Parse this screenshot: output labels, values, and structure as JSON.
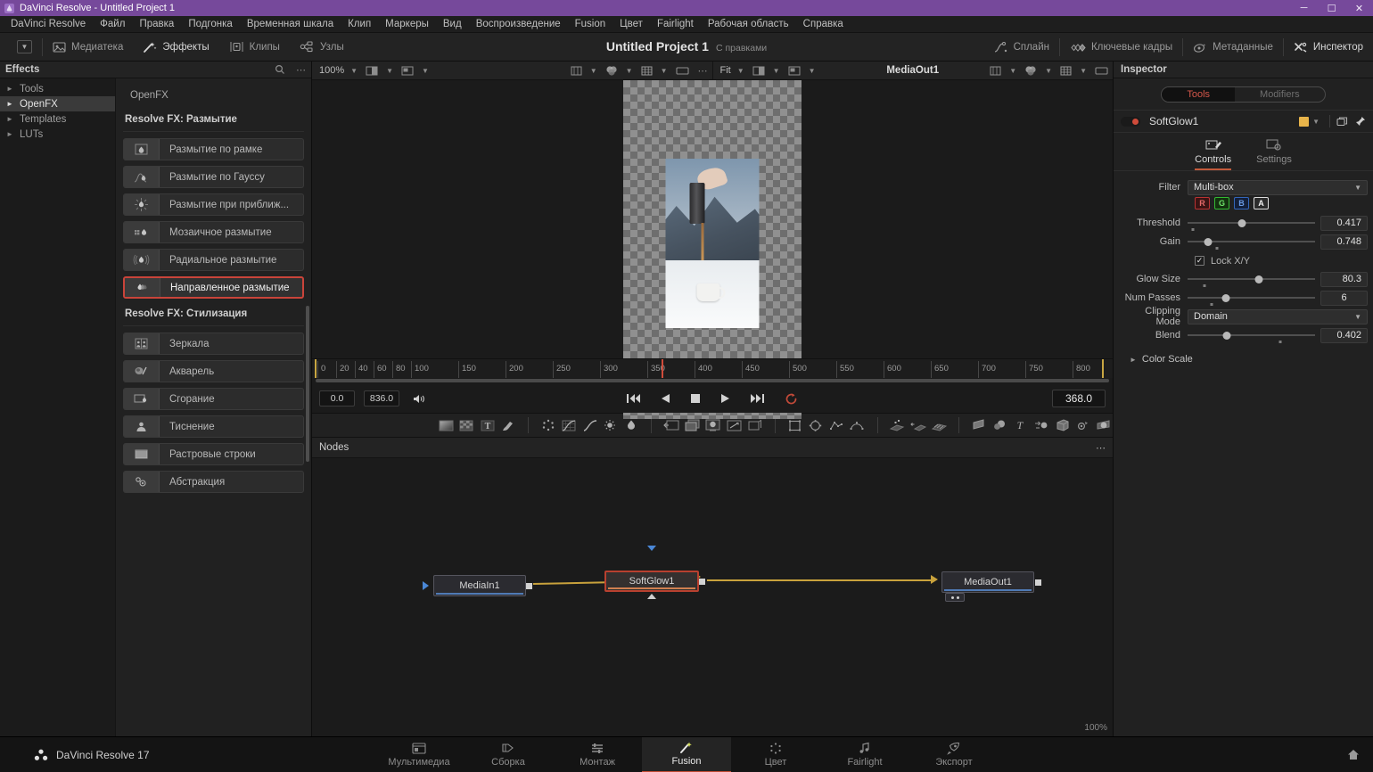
{
  "titlebar": {
    "title": "DaVinci Resolve - Untitled Project 1",
    "minimize": "─",
    "maximize": "☐",
    "close": "✕"
  },
  "menubar": {
    "items": [
      "DaVinci Resolve",
      "Файл",
      "Правка",
      "Подгонка",
      "Временная шкала",
      "Клип",
      "Маркеры",
      "Вид",
      "Воспроизведение",
      "Fusion",
      "Цвет",
      "Fairlight",
      "Рабочая область",
      "Справка"
    ]
  },
  "toolbar": {
    "left": [
      {
        "label": "",
        "icon": "chevron-down-box-icon",
        "active": false
      },
      {
        "label": "Медиатека",
        "icon": "media-pool-icon",
        "active": false
      },
      {
        "label": "Эффекты",
        "icon": "effects-wand-icon",
        "active": true
      },
      {
        "label": "Клипы",
        "icon": "clips-icon",
        "active": false
      },
      {
        "label": "Узлы",
        "icon": "nodes-icon",
        "active": false
      }
    ],
    "right": [
      {
        "label": "Сплайн",
        "icon": "spline-icon"
      },
      {
        "label": "Ключевые кадры",
        "icon": "keyframes-icon"
      },
      {
        "label": "Метаданные",
        "icon": "metadata-icon"
      },
      {
        "label": "Инспектор",
        "icon": "inspector-icon"
      }
    ],
    "project_title": "Untitled Project 1",
    "project_sub": "С правками"
  },
  "effects": {
    "header": "Effects",
    "tree": [
      {
        "label": "Tools",
        "selected": false
      },
      {
        "label": "OpenFX",
        "selected": true
      },
      {
        "label": "Templates",
        "selected": false
      },
      {
        "label": "LUTs",
        "selected": false
      }
    ],
    "breadcrumb": "OpenFX",
    "groups": [
      {
        "title": "Resolve FX: Размытие",
        "items": [
          {
            "label": "Размытие по рамке",
            "icon": "box-blur-icon",
            "selected": false
          },
          {
            "label": "Размытие по Гауссу",
            "icon": "gaussian-blur-icon",
            "selected": false
          },
          {
            "label": "Размытие при приближ...",
            "icon": "zoom-blur-icon",
            "selected": false
          },
          {
            "label": "Мозаичное размытие",
            "icon": "mosaic-blur-icon",
            "selected": false
          },
          {
            "label": "Радиальное размытие",
            "icon": "radial-blur-icon",
            "selected": false
          },
          {
            "label": "Направленное размытие",
            "icon": "directional-blur-icon",
            "selected": true
          }
        ]
      },
      {
        "title": "Resolve FX: Стилизация",
        "items": [
          {
            "label": "Зеркала",
            "icon": "mirrors-icon",
            "selected": false
          },
          {
            "label": "Акварель",
            "icon": "watercolor-icon",
            "selected": false
          },
          {
            "label": "Сгорание",
            "icon": "burn-icon",
            "selected": false
          },
          {
            "label": "Тиснение",
            "icon": "emboss-icon",
            "selected": false
          },
          {
            "label": "Растровые строки",
            "icon": "scanlines-icon",
            "selected": false
          },
          {
            "label": "Абстракция",
            "icon": "abstraction-icon",
            "selected": false
          }
        ]
      }
    ]
  },
  "viewer": {
    "left_zoom": "100%",
    "right_zoom": "Fit",
    "right_name": "MediaOut1"
  },
  "timeline": {
    "ticks": [
      "0",
      "20",
      "40",
      "60",
      "80",
      "100",
      "150",
      "200",
      "250",
      "300",
      "350",
      "400",
      "450",
      "500",
      "550",
      "600",
      "650",
      "700",
      "750",
      "800"
    ],
    "playhead": "368",
    "range_start": "0",
    "range_end": "836"
  },
  "transport": {
    "in_point": "0.0",
    "out_point": "836.0",
    "current_frame": "368.0",
    "buttons": [
      "go-to-start",
      "step-back",
      "stop",
      "play",
      "go-to-end",
      "loop"
    ]
  },
  "node_tools": {
    "group1": [
      "background-icon",
      "checkerboard-icon",
      "text-icon",
      "paint-icon"
    ],
    "group2": [
      "particles-icon",
      "color-curves-icon",
      "color-corrector-icon",
      "brightness-contrast-icon",
      "blur-icon"
    ],
    "group3": [
      "transform-icon",
      "merge-icon",
      "media-in-icon",
      "resize-icon",
      "crop-icon"
    ],
    "group4": [
      "rectangle-mask-icon",
      "ellipse-mask-icon",
      "polygon-mask-icon",
      "bspline-mask-icon"
    ],
    "group5": [
      "tracker-icon",
      "planar-tracker-icon",
      "camera-tracker-icon"
    ],
    "group6": [
      "image-plane-3d-icon",
      "shape-3d-icon",
      "text-3d-icon",
      "merge-3d-icon",
      "renderer-3d-icon",
      "camera-3d-icon",
      "sphere-map-icon"
    ]
  },
  "nodes": {
    "header": "Nodes",
    "zoom_label": "100%",
    "items": [
      {
        "label": "MediaIn1",
        "selected": false
      },
      {
        "label": "SoftGlow1",
        "selected": true
      },
      {
        "label": "MediaOut1",
        "selected": false
      }
    ]
  },
  "inspector": {
    "header": "Inspector",
    "pill": {
      "tools": "Tools",
      "modifiers": "Modifiers",
      "active": "Tools"
    },
    "tool_name": "SoftGlow1",
    "tool_color": "#e8b44a",
    "tabs": [
      {
        "label": "Controls",
        "active": true,
        "icon": "controls-icon"
      },
      {
        "label": "Settings",
        "active": false,
        "icon": "settings-icon"
      }
    ],
    "controls": {
      "filter": {
        "label": "Filter",
        "value": "Multi-box"
      },
      "channels": [
        "R",
        "G",
        "B",
        "A"
      ],
      "threshold": {
        "label": "Threshold",
        "value": "0.417",
        "pct": 43,
        "kf_pct": 4
      },
      "gain": {
        "label": "Gain",
        "value": "0.748",
        "pct": 16,
        "kf_pct": 23
      },
      "lock_xy": {
        "label": "Lock X/Y",
        "checked": true
      },
      "glow_size": {
        "label": "Glow Size",
        "value": "80.3",
        "pct": 56,
        "kf_pct": 13
      },
      "num_passes": {
        "label": "Num Passes",
        "value": "6",
        "pct": 30,
        "kf_pct": 19
      },
      "clipping_mode": {
        "label": "Clipping Mode",
        "value": "Domain"
      },
      "blend": {
        "label": "Blend",
        "value": "0.402",
        "pct": 31,
        "kf_pct": 73
      },
      "color_scale": {
        "label": "Color Scale",
        "expanded": false
      }
    }
  },
  "bottombar": {
    "brand": "DaVinci Resolve 17",
    "pages": [
      {
        "label": "Мультимедиа",
        "icon": "media-page-icon",
        "active": false
      },
      {
        "label": "Сборка",
        "icon": "cut-page-icon",
        "active": false
      },
      {
        "label": "Монтаж",
        "icon": "edit-page-icon",
        "active": false
      },
      {
        "label": "Fusion",
        "icon": "fusion-page-icon",
        "active": true
      },
      {
        "label": "Цвет",
        "icon": "color-page-icon",
        "active": false
      },
      {
        "label": "Fairlight",
        "icon": "fairlight-page-icon",
        "active": false
      },
      {
        "label": "Экспорт",
        "icon": "deliver-page-icon",
        "active": false
      }
    ],
    "home_icon": "home-icon"
  }
}
